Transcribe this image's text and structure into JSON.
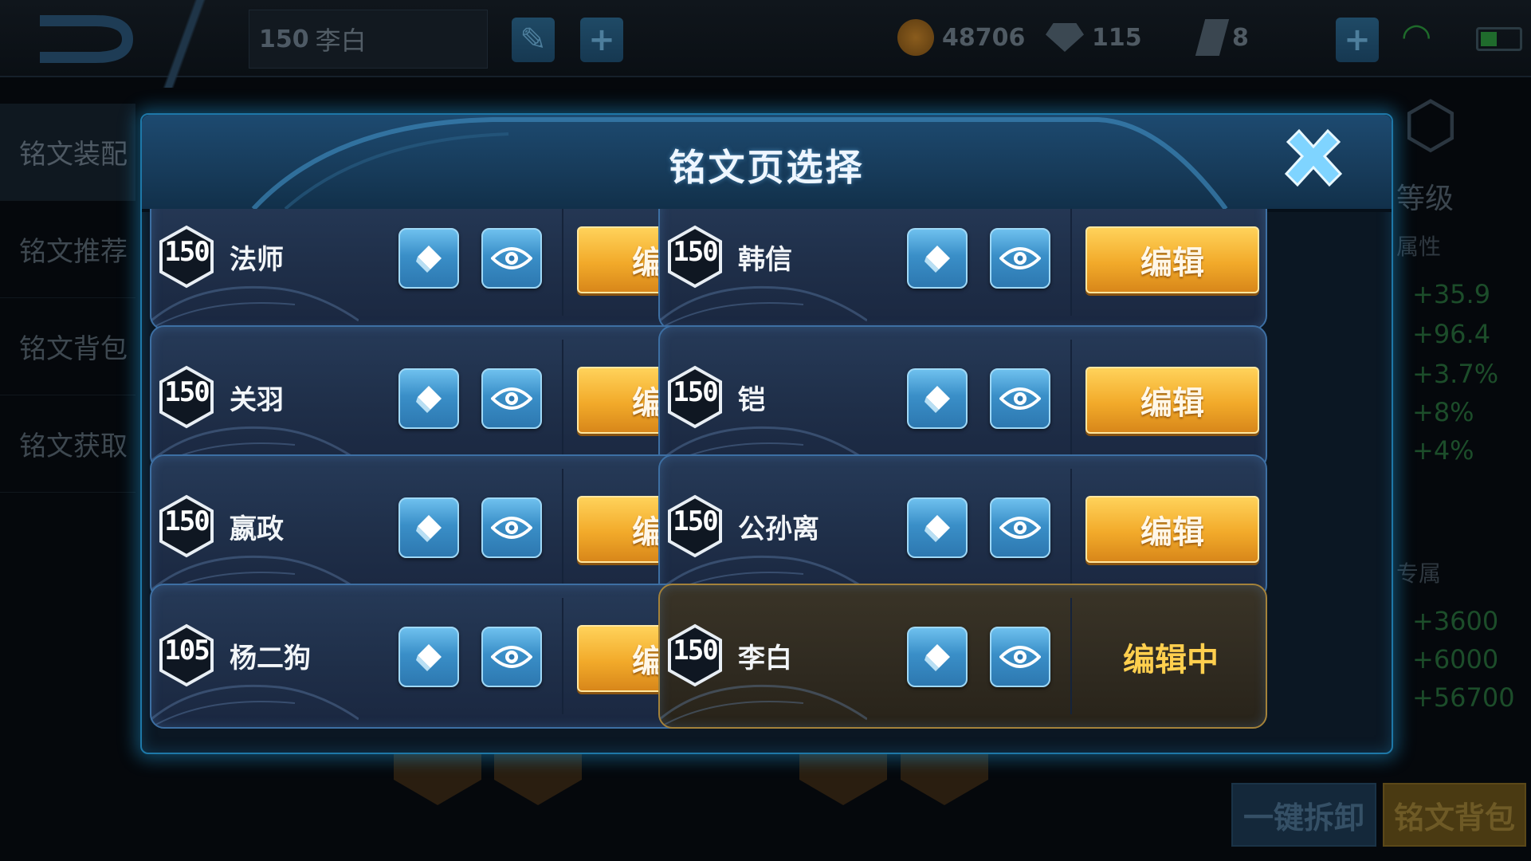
{
  "topbar": {
    "hero_level": "150",
    "hero_name": "李白",
    "gold": "48706",
    "gems": "115",
    "crystals": "8"
  },
  "side_menu": [
    {
      "label": "铭文装配"
    },
    {
      "label": "铭文推荐"
    },
    {
      "label": "铭文背包"
    },
    {
      "label": "铭文获取"
    }
  ],
  "right_panel": {
    "level_label": "等级",
    "attr_label": "属性",
    "attr_values": [
      "+35.9",
      "+96.4",
      "+3.7%",
      "+8%",
      "+4%"
    ],
    "exclusive_label": "专属",
    "exclusive_values": [
      "+3600",
      "+6000",
      "+56700"
    ]
  },
  "bottom": {
    "unload_all": "一键拆卸",
    "rune_bag": "铭文背包"
  },
  "modal": {
    "title": "铭文页选择",
    "edit_label": "编辑",
    "editing_label": "编辑中",
    "pages": [
      {
        "level": "150",
        "name": "法师"
      },
      {
        "level": "150",
        "name": "韩信"
      },
      {
        "level": "150",
        "name": "关羽"
      },
      {
        "level": "150",
        "name": "铠"
      },
      {
        "level": "150",
        "name": "嬴政"
      },
      {
        "level": "150",
        "name": "公孙离"
      },
      {
        "level": "105",
        "name": "杨二狗"
      },
      {
        "level": "150",
        "name": "李白",
        "editing": true
      }
    ]
  },
  "colors": {
    "accent_blue": "#1e78a8",
    "edit_gold": "#f2aa2a",
    "editing_text": "#ffcf4e",
    "active_card_border": "#a4823a"
  }
}
